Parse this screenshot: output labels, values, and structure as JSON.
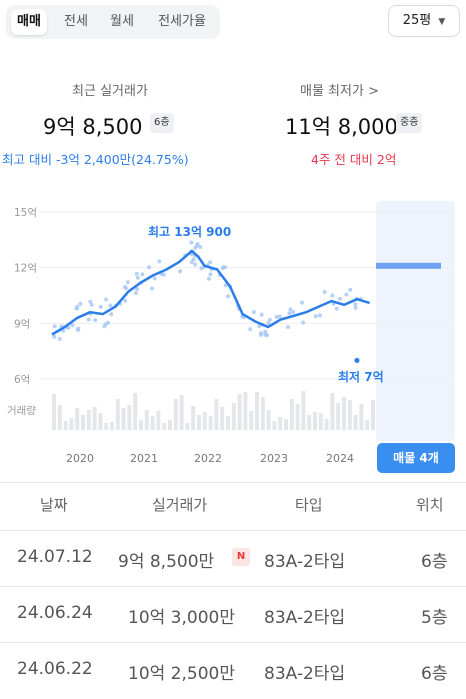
{
  "tabs": [
    {
      "label": "매매"
    },
    {
      "label": "전세"
    },
    {
      "label": "월세"
    },
    {
      "label": "전세가율"
    }
  ],
  "size_select": {
    "label": "25평"
  },
  "summary": {
    "recent": {
      "label": "최근 실거래가",
      "price": "9억 8,500",
      "floor": "6층",
      "delta": "최고 대비 -3억 2,400만(24.75%)"
    },
    "listing": {
      "label": "매물 최저가 >",
      "price": "11억 8,000",
      "floor": "중층",
      "delta": "4주 전 대비 2억"
    }
  },
  "chart_data": {
    "type": "line",
    "x_ticks": [
      "2020",
      "2021",
      "2022",
      "2023",
      "2024"
    ],
    "y_ticks": [
      "15억",
      "12억",
      "9억",
      "6억"
    ],
    "ylim": [
      6,
      15
    ],
    "volume_label": "거래량",
    "max_annotation": "최고 13억 900",
    "min_annotation": "최저 7억",
    "listing_band_value": 12.1,
    "series": [
      {
        "x": [
          2019.6,
          2019.8,
          2020.0,
          2020.2,
          2020.4,
          2020.6,
          2020.8,
          2021.0,
          2021.2,
          2021.4,
          2021.6,
          2021.8,
          2021.9,
          2022.0,
          2022.2,
          2022.4,
          2022.6,
          2022.8,
          2023.0,
          2023.2,
          2023.4,
          2023.6,
          2023.8,
          2024.0,
          2024.2,
          2024.4,
          2024.6
        ],
        "y": [
          8.4,
          8.8,
          9.3,
          9.6,
          9.5,
          9.9,
          10.7,
          11.2,
          11.6,
          11.9,
          12.3,
          12.9,
          12.6,
          12.1,
          11.9,
          11.0,
          9.5,
          9.1,
          8.8,
          9.2,
          9.4,
          9.6,
          9.9,
          10.2,
          10.0,
          10.3,
          10.1
        ]
      }
    ],
    "min_point": {
      "x": 2024.4,
      "y": 7.0
    }
  },
  "listing_button": {
    "label": "매물 4개"
  },
  "table": {
    "headers": [
      "날짜",
      "실거래가",
      "타입",
      "위치"
    ],
    "rows": [
      {
        "date": "24.07.12",
        "price": "9억 8,500만",
        "badge": "N",
        "type": "83A-2타입",
        "floor": "6층"
      },
      {
        "date": "24.06.24",
        "price": "10억 3,000만",
        "badge": "",
        "type": "83A-2타입",
        "floor": "5층"
      },
      {
        "date": "24.06.22",
        "price": "10억 2,500만",
        "badge": "",
        "type": "83A-2타입",
        "floor": "6층"
      }
    ]
  }
}
